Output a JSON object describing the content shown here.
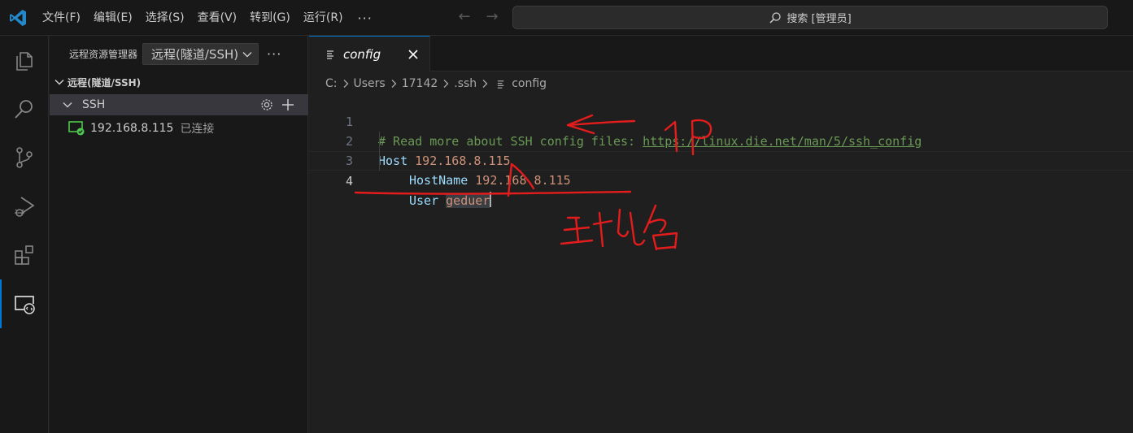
{
  "menu": [
    "文件(F)",
    "编辑(E)",
    "选择(S)",
    "查看(V)",
    "转到(G)",
    "运行(R)"
  ],
  "menu_more": "···",
  "search": {
    "label": "搜索 [管理员]"
  },
  "sidebar": {
    "title": "远程资源管理器",
    "select_value": "远程(隧道/SSH)",
    "more": "···",
    "section_title": "远程(隧道/SSH)",
    "group_label": "SSH",
    "host_label": "192.168.8.115",
    "host_status": "已连接"
  },
  "editor": {
    "tab_label": "config",
    "breadcrumb": [
      "C:",
      "Users",
      "17142",
      ".ssh",
      "config"
    ],
    "lines": [
      {
        "num": "1",
        "comment": "# Read more about SSH config files: ",
        "link": "https://linux.die.net/man/5/ssh_config"
      },
      {
        "num": "2",
        "key": "Host",
        "value": "192.168.8.115"
      },
      {
        "num": "3",
        "key": "HostName",
        "value": "192.168.8.115"
      },
      {
        "num": "4",
        "key": "User",
        "value": "geduer"
      }
    ]
  },
  "colors": {
    "accent": "#0078d4",
    "annotation": "#e51c1c",
    "comment": "#6a9955",
    "keyword": "#9cdcfe",
    "string": "#ce9178",
    "connected": "#4ec94e"
  }
}
